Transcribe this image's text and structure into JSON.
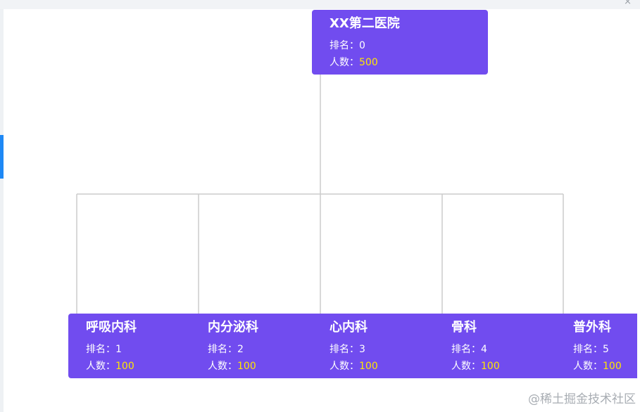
{
  "window": {
    "close_glyph": "×"
  },
  "labels": {
    "rank": "排名：",
    "count": "人数："
  },
  "root": {
    "name": "XX第二医院",
    "rank": "0",
    "count": "500"
  },
  "children": [
    {
      "name": "呼吸内科",
      "rank": "1",
      "count": "100"
    },
    {
      "name": "内分泌科",
      "rank": "2",
      "count": "100"
    },
    {
      "name": "心内科",
      "rank": "3",
      "count": "100"
    },
    {
      "name": "骨科",
      "rank": "4",
      "count": "100"
    },
    {
      "name": "普外科",
      "rank": "5",
      "count": "100"
    }
  ],
  "watermark": "@稀土掘金技术社区",
  "colors": {
    "node": "#714cef",
    "count_value": "#ffe600",
    "connector": "#cccccc",
    "side_tab": "#1e88f5"
  }
}
